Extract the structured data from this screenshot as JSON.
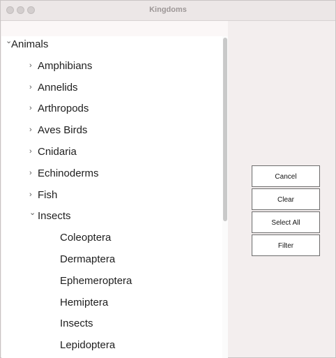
{
  "window": {
    "title": "Kingdoms"
  },
  "tree": {
    "items": [
      {
        "label": "Animals",
        "expanded": true,
        "level": 0
      },
      {
        "label": "Amphibians",
        "expanded": false,
        "level": 1
      },
      {
        "label": "Annelids",
        "expanded": false,
        "level": 1
      },
      {
        "label": "Arthropods",
        "expanded": false,
        "level": 1
      },
      {
        "label": "Aves Birds",
        "expanded": false,
        "level": 1
      },
      {
        "label": "Cnidaria",
        "expanded": false,
        "level": 1
      },
      {
        "label": "Echinoderms",
        "expanded": false,
        "level": 1
      },
      {
        "label": "Fish",
        "expanded": false,
        "level": 1
      },
      {
        "label": "Insects",
        "expanded": true,
        "level": 1
      },
      {
        "label": "Coleoptera",
        "level": 2
      },
      {
        "label": "Dermaptera",
        "level": 2
      },
      {
        "label": "Ephemeroptera",
        "level": 2
      },
      {
        "label": "Hemiptera",
        "level": 2
      },
      {
        "label": "Insects",
        "level": 2
      },
      {
        "label": "Lepidoptera",
        "level": 2
      }
    ]
  },
  "buttons": {
    "cancel": "Cancel",
    "clear": "Clear",
    "select_all": "Select All",
    "filter": "Filter"
  },
  "colors": {
    "background": "#f2eded",
    "tree_background": "#ffffff",
    "button_border": "#6b6b6b"
  },
  "icons": {
    "expanded": "chevron-down-icon",
    "collapsed": "chevron-right-icon"
  }
}
